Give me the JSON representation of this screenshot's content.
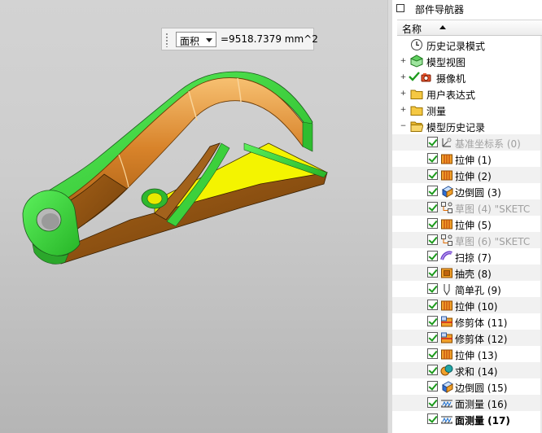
{
  "measure": {
    "mode": "面积",
    "value": "=9518.7379 mm^2"
  },
  "navigator": {
    "title": "部件导航器",
    "column_name": "名称",
    "top_nodes": [
      {
        "label": "历史记录模式",
        "icon": "clock-icon"
      },
      {
        "label": "模型视图",
        "icon": "model-views-icon"
      },
      {
        "label": "摄像机",
        "icon": "camera-icon"
      },
      {
        "label": "用户表达式",
        "icon": "folder-icon"
      },
      {
        "label": "测量",
        "icon": "folder-icon"
      },
      {
        "label": "模型历史记录",
        "icon": "open-folder-icon"
      }
    ],
    "features": [
      {
        "label": "基准坐标系 (0)",
        "icon": "datum-csys-icon",
        "dim": true,
        "bold": false
      },
      {
        "label": "拉伸 (1)",
        "icon": "extrude-icon",
        "dim": false,
        "bold": false
      },
      {
        "label": "拉伸 (2)",
        "icon": "extrude-icon",
        "dim": false,
        "bold": false
      },
      {
        "label": "边倒圆 (3)",
        "icon": "edge-blend-icon",
        "dim": false,
        "bold": false
      },
      {
        "label": "草图 (4) \"SKETC",
        "icon": "sketch-icon",
        "dim": true,
        "bold": false
      },
      {
        "label": "拉伸 (5)",
        "icon": "extrude-icon",
        "dim": false,
        "bold": false
      },
      {
        "label": "草图 (6) \"SKETC",
        "icon": "sketch-icon",
        "dim": true,
        "bold": false
      },
      {
        "label": "扫掠 (7)",
        "icon": "sweep-icon",
        "dim": false,
        "bold": false
      },
      {
        "label": "抽壳 (8)",
        "icon": "shell-icon",
        "dim": false,
        "bold": false
      },
      {
        "label": "简单孔 (9)",
        "icon": "hole-icon",
        "dim": false,
        "bold": false
      },
      {
        "label": "拉伸 (10)",
        "icon": "extrude-icon",
        "dim": false,
        "bold": false
      },
      {
        "label": "修剪体 (11)",
        "icon": "trim-body-icon",
        "dim": false,
        "bold": false
      },
      {
        "label": "修剪体 (12)",
        "icon": "trim-body-icon",
        "dim": false,
        "bold": false
      },
      {
        "label": "拉伸 (13)",
        "icon": "extrude-icon",
        "dim": false,
        "bold": false
      },
      {
        "label": "求和 (14)",
        "icon": "unite-icon",
        "dim": false,
        "bold": false
      },
      {
        "label": "边倒圆 (15)",
        "icon": "edge-blend-icon",
        "dim": false,
        "bold": false
      },
      {
        "label": "面测量 (16)",
        "icon": "face-measure-icon",
        "dim": false,
        "bold": false
      },
      {
        "label": "面测量 (17)",
        "icon": "face-measure-icon",
        "dim": false,
        "bold": true
      }
    ]
  },
  "colors": {
    "body_orange": "#d07a1c",
    "face_green": "#3fd23f",
    "face_yellow": "#f4f400",
    "body_brown": "#8a4f10"
  }
}
